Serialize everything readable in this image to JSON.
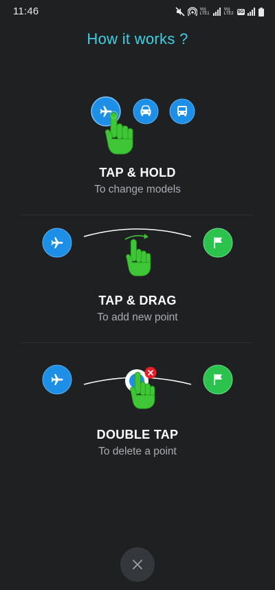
{
  "status_bar": {
    "time": "11:46",
    "sim1_label_top": "Vo)",
    "sim1_label_bottom": "LTE1",
    "sim2_label_top": "Vo)",
    "sim2_label_bottom": "LTE2",
    "network_label": "5G"
  },
  "title": "How it works ?",
  "steps": [
    {
      "heading": "TAP & HOLD",
      "description": "To change models"
    },
    {
      "heading": "TAP & DRAG",
      "description": "To add new point"
    },
    {
      "heading": "DOUBLE TAP",
      "description": "To delete a point"
    }
  ],
  "colors": {
    "accent_title": "#3fd0e3",
    "blue_button": "#1e8fe6",
    "green_button": "#2bc24e",
    "hand": "#3fc636",
    "delete_badge": "#e8202a",
    "close_button_bg": "#34383d"
  },
  "icons": {
    "plane": "airplane-icon",
    "car": "car-icon",
    "bus": "bus-icon",
    "flag": "flag-icon",
    "hand": "pointing-hand-icon",
    "close": "close-icon"
  }
}
